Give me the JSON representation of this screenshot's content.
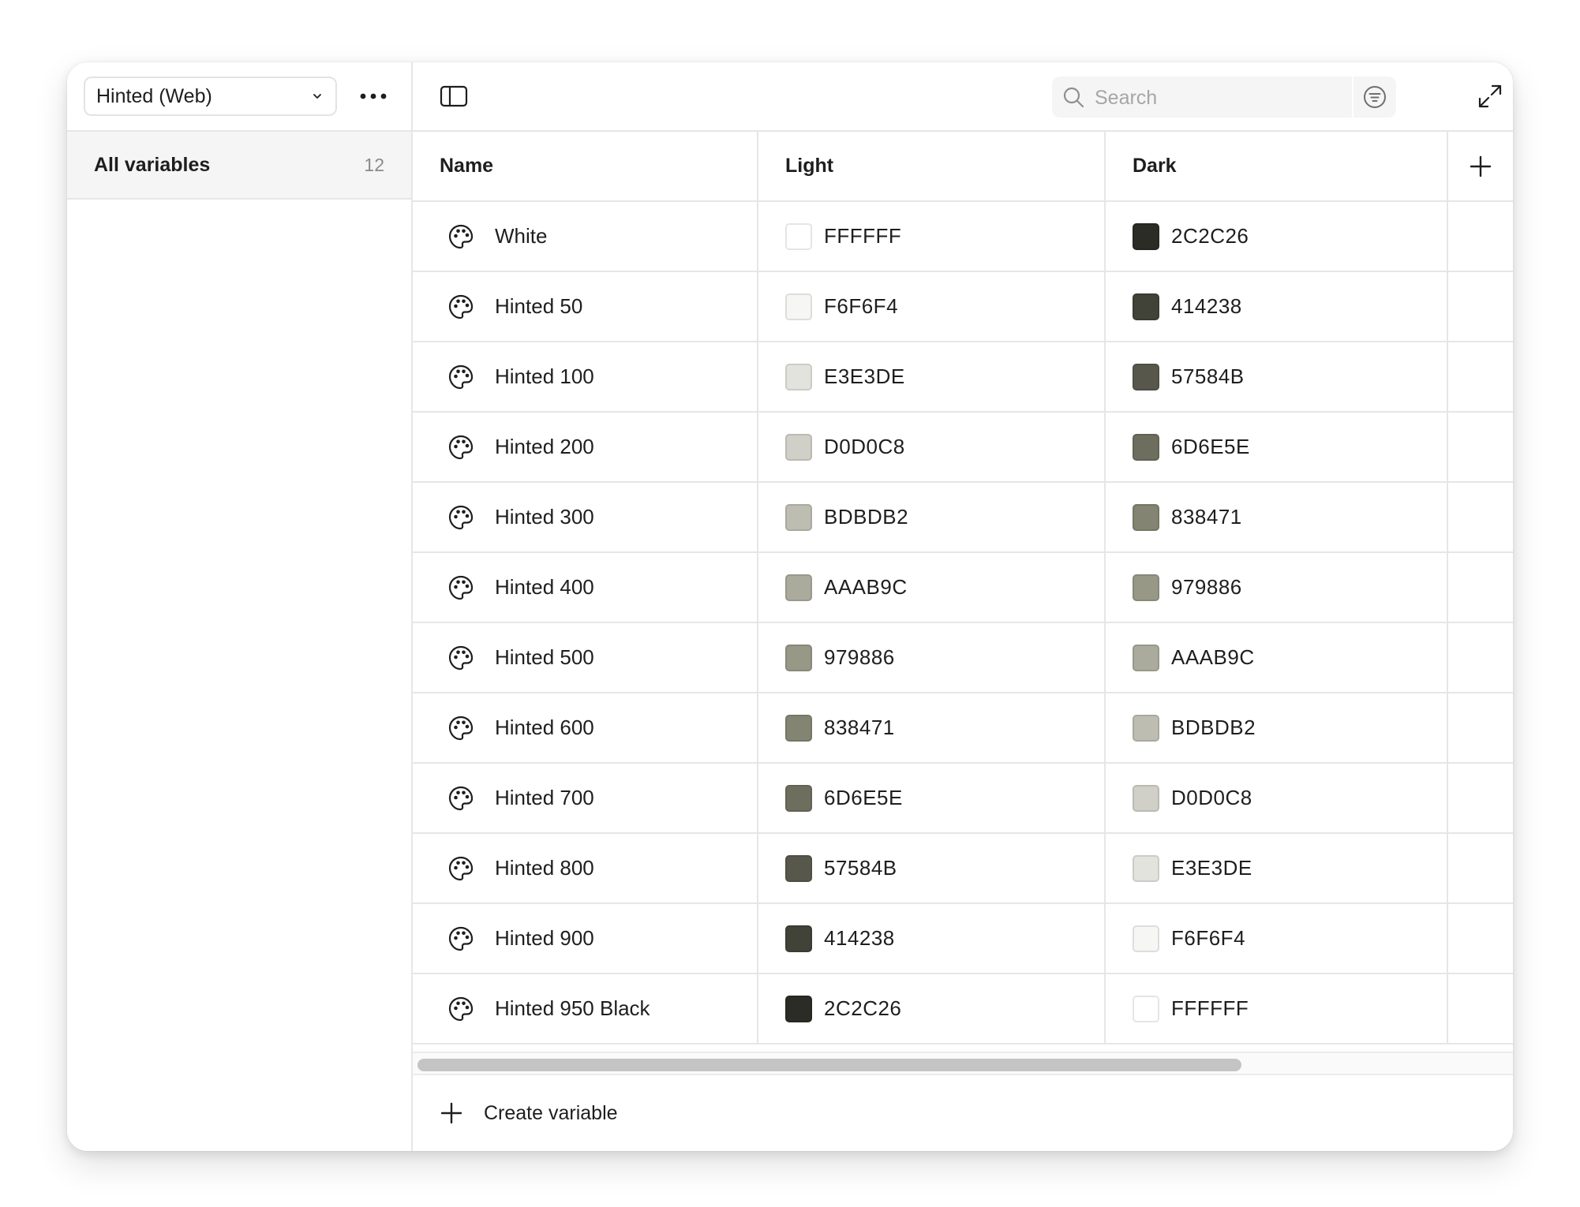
{
  "collection": {
    "selected": "Hinted (Web)"
  },
  "sidebar": {
    "items": [
      {
        "label": "All variables",
        "count": "12"
      }
    ]
  },
  "search": {
    "placeholder": "Search",
    "value": ""
  },
  "table": {
    "columns": {
      "name": "Name",
      "light": "Light",
      "dark": "Dark"
    },
    "rows": [
      {
        "name": "White",
        "light": "FFFFFF",
        "dark": "2C2C26",
        "light_color": "#FFFFFF",
        "dark_color": "#2C2C26"
      },
      {
        "name": "Hinted 50",
        "light": "F6F6F4",
        "dark": "414238",
        "light_color": "#F6F6F4",
        "dark_color": "#414238"
      },
      {
        "name": "Hinted 100",
        "light": "E3E3DE",
        "dark": "57584B",
        "light_color": "#E3E3DE",
        "dark_color": "#57584B"
      },
      {
        "name": "Hinted 200",
        "light": "D0D0C8",
        "dark": "6D6E5E",
        "light_color": "#D0D0C8",
        "dark_color": "#6D6E5E"
      },
      {
        "name": "Hinted 300",
        "light": "BDBDB2",
        "dark": "838471",
        "light_color": "#BDBDB2",
        "dark_color": "#838471"
      },
      {
        "name": "Hinted 400",
        "light": "AAAB9C",
        "dark": "979886",
        "light_color": "#AAAB9C",
        "dark_color": "#979886"
      },
      {
        "name": "Hinted 500",
        "light": "979886",
        "dark": "AAAB9C",
        "light_color": "#979886",
        "dark_color": "#AAAB9C"
      },
      {
        "name": "Hinted 600",
        "light": "838471",
        "dark": "BDBDB2",
        "light_color": "#838471",
        "dark_color": "#BDBDB2"
      },
      {
        "name": "Hinted 700",
        "light": "6D6E5E",
        "dark": "D0D0C8",
        "light_color": "#6D6E5E",
        "dark_color": "#D0D0C8"
      },
      {
        "name": "Hinted 800",
        "light": "57584B",
        "dark": "E3E3DE",
        "light_color": "#57584B",
        "dark_color": "#E3E3DE"
      },
      {
        "name": "Hinted 900",
        "light": "414238",
        "dark": "F6F6F4",
        "light_color": "#414238",
        "dark_color": "#F6F6F4"
      },
      {
        "name": "Hinted 950 Black",
        "light": "2C2C26",
        "dark": "FFFFFF",
        "light_color": "#2C2C26",
        "dark_color": "#FFFFFF"
      }
    ]
  },
  "footer": {
    "create_label": "Create variable"
  },
  "icons": {
    "collection_chevron": "chevron-down-icon",
    "more": "more-horizontal-icon",
    "sidebar_toggle": "sidebar-toggle-icon",
    "search": "search-icon",
    "filter": "filter-icon",
    "expand": "expand-icon",
    "close": "close-icon",
    "row": "palette-icon",
    "add_column": "plus-icon",
    "create": "plus-icon"
  }
}
